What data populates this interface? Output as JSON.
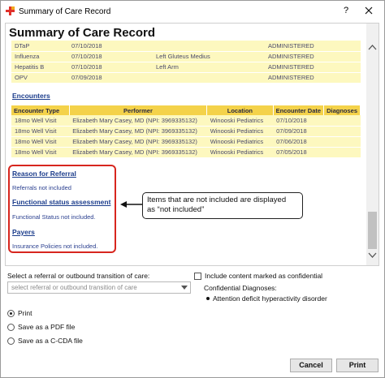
{
  "window": {
    "title": "Summary of Care Record",
    "help": "?",
    "close": "close"
  },
  "record": {
    "title": "Summary of Care Record",
    "immunizations": [
      {
        "vaccine": "DTaP",
        "date": "07/10/2018",
        "site": "",
        "status": "ADMINISTERED"
      },
      {
        "vaccine": "Influenza",
        "date": "07/10/2018",
        "site": "Left Gluteus Medius",
        "status": "ADMINISTERED"
      },
      {
        "vaccine": "Hepatitis B",
        "date": "07/10/2018",
        "site": "Left Arm",
        "status": "ADMINISTERED"
      },
      {
        "vaccine": "OPV",
        "date": "07/09/2018",
        "site": "",
        "status": "ADMINISTERED"
      }
    ],
    "encounters": {
      "heading": "Encounters",
      "columns": [
        "Encounter Type",
        "Performer",
        "Location",
        "Encounter Date",
        "Diagnoses"
      ],
      "rows": [
        {
          "type": "18mo Well Visit",
          "performer": "Elizabeth Mary Casey, MD (NPI: 3969335132)",
          "location": "Winooski Pediatrics",
          "date": "07/10/2018",
          "diagnoses": ""
        },
        {
          "type": "18mo Well Visit",
          "performer": "Elizabeth Mary Casey, MD (NPI: 3969335132)",
          "location": "Winooski Pediatrics",
          "date": "07/09/2018",
          "diagnoses": ""
        },
        {
          "type": "18mo Well Visit",
          "performer": "Elizabeth Mary Casey, MD (NPI: 3969335132)",
          "location": "Winooski Pediatrics",
          "date": "07/06/2018",
          "diagnoses": ""
        },
        {
          "type": "18mo Well Visit",
          "performer": "Elizabeth Mary Casey, MD (NPI: 3969335132)",
          "location": "Winooski Pediatrics",
          "date": "07/05/2018",
          "diagnoses": ""
        }
      ]
    },
    "reason_for_referral": {
      "heading": "Reason for Referral",
      "note": "Referrals not included"
    },
    "functional_status": {
      "heading": "Functional status assessment",
      "note": "Functional Status not included."
    },
    "payers": {
      "heading": "Payers",
      "note": "Insurance Policies not included."
    }
  },
  "callout": {
    "line1": "Items that are not included are displayed",
    "line2": "as “not included”"
  },
  "referral": {
    "label": "Select a referral or outbound transition of care:",
    "placeholder": "select referral or outbound transition of care"
  },
  "confidential": {
    "checkbox_label": "Include content marked as confidential",
    "diagnoses_label": "Confidential Diagnoses:",
    "diagnoses": [
      "Attention deficit hyperactivity disorder"
    ]
  },
  "output": {
    "options": [
      "Print",
      "Save as a PDF file",
      "Save as a C-CDA file"
    ],
    "selected": "Print"
  },
  "buttons": {
    "cancel": "Cancel",
    "print": "Print"
  },
  "colors": {
    "row_bg": "#fdf8bf",
    "header_bg": "#f4d24a",
    "link": "#1c3d8c",
    "highlight_box": "#d7261e"
  }
}
